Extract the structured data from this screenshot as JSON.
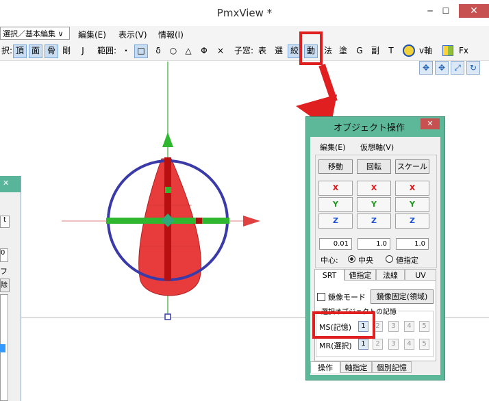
{
  "window": {
    "title": "PmxView *",
    "minimize": "─",
    "maximize": "☐",
    "close": "✕"
  },
  "menubar": {
    "mode_select": "選択／基本編集 ∨",
    "menus": [
      "編集(E)",
      "表示(V)",
      "情報(I)"
    ]
  },
  "toolbar": {
    "select_prefix": "択:",
    "select_items": [
      "頂",
      "面",
      "骨",
      "剛",
      "J"
    ],
    "range_label": "範囲:",
    "range_items": [
      "・",
      "□",
      "δ",
      "○",
      "△",
      "Φ",
      "×"
    ],
    "subwindow_label": "子窓:",
    "subwindow_items": [
      "表",
      "選",
      "絞",
      "動",
      "法",
      "塗",
      "G",
      "副",
      "T"
    ],
    "axis_label": "v軸",
    "fx_label": "Fx"
  },
  "left_panel": {
    "close": "✕",
    "fragments": [
      "t",
      "0",
      "フ",
      "除"
    ]
  },
  "dialog": {
    "title": "オブジェクト操作",
    "close": "✕",
    "menus": [
      "編集(E)",
      "仮想軸(V)"
    ],
    "mode_buttons": [
      "移動",
      "回転",
      "スケール"
    ],
    "axis_rows": [
      "X",
      "Y",
      "Z"
    ],
    "axis_colors": {
      "X": "#e01818",
      "Y": "#1a9a1a",
      "Z": "#1f4fd8"
    },
    "values": [
      "0.01",
      "1.0",
      "1.0"
    ],
    "center_label": "中心:",
    "center_options": [
      "中央",
      "値指定"
    ],
    "center_selected": "中央",
    "tabs": [
      "SRT",
      "値指定",
      "法線",
      "UV"
    ],
    "mirror_checkbox": "鏡像モード",
    "mirror_fix_button": "鏡像固定(領域)",
    "memory_group": "選択オブジェクトの記憶",
    "ms_label": "MS(記憶)",
    "mr_label": "MR(選択)",
    "slots": [
      "1",
      "2",
      "3",
      "4",
      "5"
    ],
    "bottom_tabs": [
      "操作",
      "軸指定",
      "個別記憶"
    ]
  },
  "colors": {
    "accent_red": "#e02020",
    "dialog_frame": "#5cb899",
    "object_fill": "#e83c3c",
    "gizmo_ring": "#3a3aa8"
  }
}
